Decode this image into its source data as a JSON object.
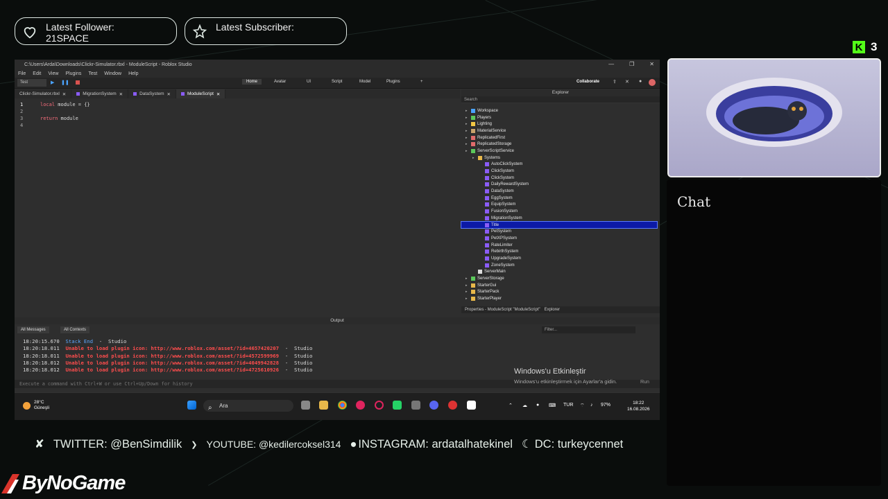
{
  "overlay": {
    "follower_label": "Latest Follower:",
    "follower_name": "21SPACE",
    "subscriber_label": "Latest Subscriber:",
    "subscriber_name": "",
    "kick_count": "3",
    "chat_title": "Chat",
    "socials": [
      "TWITTER: @BenSimdilik",
      "YOUTUBE: @kedilercoksel314",
      "INSTAGRAM: ardatalhatekinel",
      "DC: turkeycennet"
    ],
    "brand": "ByNoGame",
    "accent_color": "#53fc18"
  },
  "studio": {
    "window_title": "C:\\Users\\Arda\\Downloads\\Clickr-Simulator.rbxl - ModuleScript - Roblox Studio",
    "menu": [
      "File",
      "Edit",
      "View",
      "Plugins",
      "Test",
      "Window",
      "Help"
    ],
    "mode": "Test",
    "ribbon_tabs": [
      "Home",
      "Avatar",
      "UI",
      "Script",
      "Model",
      "Plugins"
    ],
    "collaborate": "Collaborate",
    "editor_tabs": [
      "Clickr-Simulator.rbxl",
      "MigrationSystem",
      "DataSystem",
      "ModuleScript"
    ],
    "code_lines": [
      {
        "num": "1",
        "kw": "local",
        "rest": " module = {}"
      },
      {
        "num": "2",
        "kw": "",
        "rest": ""
      },
      {
        "num": "3",
        "kw": "return",
        "rest": " module"
      },
      {
        "num": "4",
        "kw": "",
        "rest": ""
      }
    ],
    "explorer": {
      "title": "Explorer",
      "search_placeholder": "Search",
      "items": [
        {
          "label": "Workspace",
          "depth": 0,
          "color": "#4aa3ff"
        },
        {
          "label": "Players",
          "depth": 0,
          "color": "#5bc85b"
        },
        {
          "label": "Lighting",
          "depth": 0,
          "color": "#f2c744"
        },
        {
          "label": "MaterialService",
          "depth": 0,
          "color": "#c9a36b"
        },
        {
          "label": "ReplicatedFirst",
          "depth": 0,
          "color": "#e06b6b"
        },
        {
          "label": "ReplicatedStorage",
          "depth": 0,
          "color": "#e06b6b"
        },
        {
          "label": "ServerScriptService",
          "depth": 0,
          "color": "#5bc85b"
        },
        {
          "label": "Systems",
          "depth": 1,
          "color": "#e8b84a"
        },
        {
          "label": "AutoClickSystem",
          "depth": 2,
          "color": "#8a5cf6"
        },
        {
          "label": "ClickSystem",
          "depth": 2,
          "color": "#8a5cf6"
        },
        {
          "label": "ClickSystem",
          "depth": 2,
          "color": "#8a5cf6"
        },
        {
          "label": "DailyRewardSystem",
          "depth": 2,
          "color": "#8a5cf6"
        },
        {
          "label": "DataSystem",
          "depth": 2,
          "color": "#8a5cf6"
        },
        {
          "label": "EggSystem",
          "depth": 2,
          "color": "#8a5cf6"
        },
        {
          "label": "EquipSystem",
          "depth": 2,
          "color": "#8a5cf6"
        },
        {
          "label": "FusionSystem",
          "depth": 2,
          "color": "#8a5cf6"
        },
        {
          "label": "MigrationSystem",
          "depth": 2,
          "color": "#8a5cf6"
        },
        {
          "label": "Title",
          "depth": 2,
          "color": "#8a5cf6",
          "selected": true
        },
        {
          "label": "PetSystem",
          "depth": 2,
          "color": "#8a5cf6"
        },
        {
          "label": "PetXPSystem",
          "depth": 2,
          "color": "#8a5cf6"
        },
        {
          "label": "RateLimiter",
          "depth": 2,
          "color": "#8a5cf6"
        },
        {
          "label": "RebirthSystem",
          "depth": 2,
          "color": "#8a5cf6"
        },
        {
          "label": "UpgradeSystem",
          "depth": 2,
          "color": "#8a5cf6"
        },
        {
          "label": "ZoneSystem",
          "depth": 2,
          "color": "#8a5cf6"
        },
        {
          "label": "ServerMain",
          "depth": 1,
          "color": "#dddddd"
        },
        {
          "label": "ServerStorage",
          "depth": 0,
          "color": "#5bc85b"
        },
        {
          "label": "StarterGui",
          "depth": 0,
          "color": "#e8b84a"
        },
        {
          "label": "StarterPack",
          "depth": 0,
          "color": "#e8b84a"
        },
        {
          "label": "StarterPlayer",
          "depth": 0,
          "color": "#e8b84a"
        }
      ],
      "footer_props": "Properties - ModuleScript \"ModuleScript\"",
      "footer_explorer": "Explorer"
    },
    "output": {
      "title": "Output",
      "filter_messages": "All Messages",
      "filter_contexts": "All Contexts",
      "filter_placeholder": "Filter...",
      "lines": [
        {
          "time": "18:20:15.670",
          "msg": "Stack End",
          "type": "info",
          "src": "Studio"
        },
        {
          "time": "18:20:18.011",
          "msg": "Unable to load plugin icon: http://www.roblox.com/asset/?id=4657420207",
          "type": "error",
          "src": "Studio"
        },
        {
          "time": "18:20:18.011",
          "msg": "Unable to load plugin icon: http://www.roblox.com/asset/?id=4572599969",
          "type": "error",
          "src": "Studio"
        },
        {
          "time": "18:20:18.012",
          "msg": "Unable to load plugin icon: http://www.roblox.com/asset/?id=4049942828",
          "type": "error",
          "src": "Studio"
        },
        {
          "time": "18:20:18.012",
          "msg": "Unable to load plugin icon: http://www.roblox.com/asset/?id=4725610926",
          "type": "error",
          "src": "Studio"
        }
      ],
      "command_placeholder": "Execute a command with Ctrl+W or use Ctrl+Up/Down for history",
      "run_label": "Run"
    },
    "activation": {
      "title": "Windows'u Etkinleştir",
      "subtitle": "Windows'u etkinleştirmek için Ayarlar'a gidin."
    }
  },
  "taskbar": {
    "temp": "28°C",
    "weather": "Güneşli",
    "search": "Ara",
    "lang": "TUR",
    "battery": "97%",
    "time": "18:22",
    "date": "16.08.2026"
  }
}
